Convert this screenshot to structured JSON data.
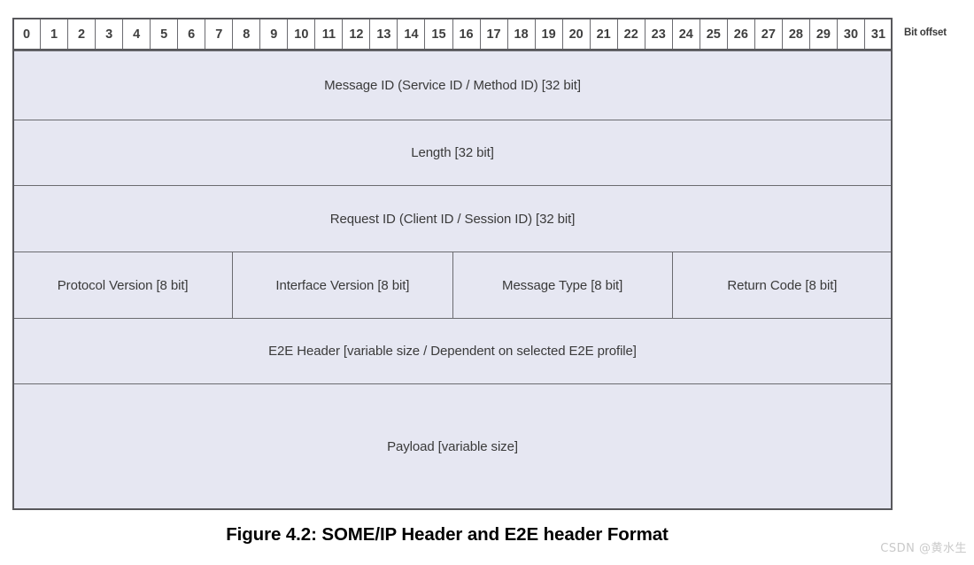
{
  "figure": {
    "caption": "Figure 4.2: SOME/IP Header and E2E header Format",
    "bit_offset_label": "Bit offset",
    "watermark": "CSDN @黄水生",
    "colors": {
      "field_background": "#e6e7f2",
      "ruler_background": "#ffffff",
      "border": "#6b6b70",
      "frame": "#58585c",
      "text": "#3c3c3c",
      "watermark": "#c9c9c9"
    }
  },
  "bit_ruler": {
    "bits": [
      "0",
      "1",
      "2",
      "3",
      "4",
      "5",
      "6",
      "7",
      "8",
      "9",
      "10",
      "11",
      "12",
      "13",
      "14",
      "15",
      "16",
      "17",
      "18",
      "19",
      "20",
      "21",
      "22",
      "23",
      "24",
      "25",
      "26",
      "27",
      "28",
      "29",
      "30",
      "31"
    ]
  },
  "rows": [
    {
      "name": "message-id",
      "cells": [
        {
          "label": "Message ID (Service ID / Method ID) [32 bit]",
          "span": 32
        }
      ]
    },
    {
      "name": "length",
      "cells": [
        {
          "label": "Length [32 bit]",
          "span": 32
        }
      ]
    },
    {
      "name": "request-id",
      "cells": [
        {
          "label": "Request ID (Client ID / Session ID) [32 bit]",
          "span": 32
        }
      ]
    },
    {
      "name": "version-type-code",
      "cells": [
        {
          "label": "Protocol Version [8 bit]",
          "span": 8
        },
        {
          "label": "Interface Version [8 bit]",
          "span": 8
        },
        {
          "label": "Message Type [8 bit]",
          "span": 8
        },
        {
          "label": "Return Code [8 bit]",
          "span": 8
        }
      ]
    },
    {
      "name": "e2e-header",
      "cells": [
        {
          "label": "E2E Header [variable size / Dependent on selected E2E profile]",
          "span": 32
        }
      ]
    },
    {
      "name": "payload",
      "cells": [
        {
          "label": "Payload [variable size]",
          "span": 32
        }
      ]
    }
  ]
}
